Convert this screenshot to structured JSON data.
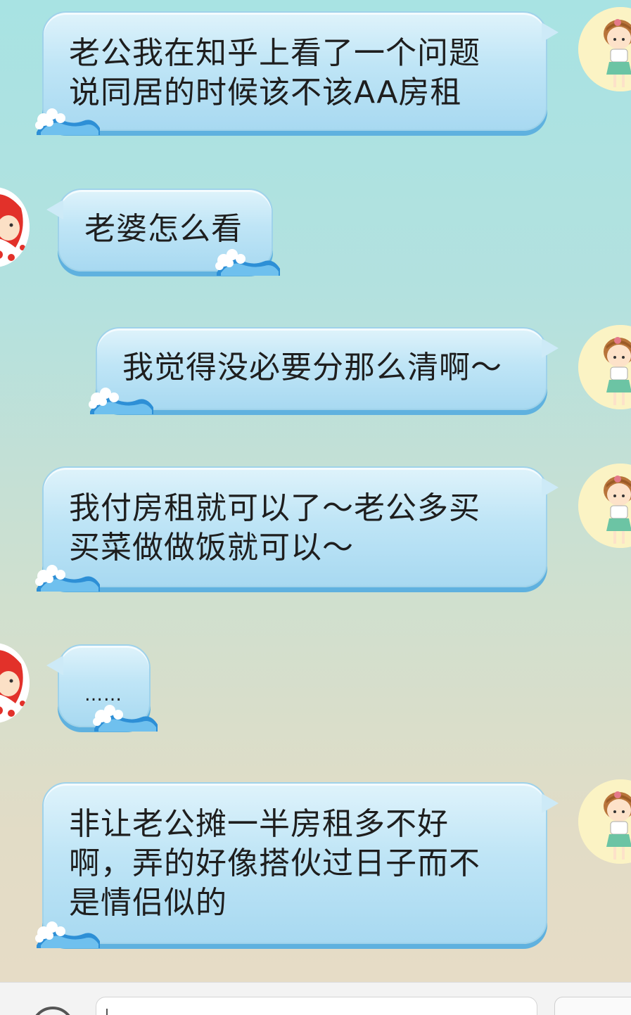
{
  "messages": [
    {
      "sender": "self",
      "text": "老公我在知乎上看了一个问题\n说同居的时候该不该AA房租"
    },
    {
      "sender": "other",
      "text": "老婆怎么看"
    },
    {
      "sender": "self",
      "text": "我觉得没必要分那么清啊～"
    },
    {
      "sender": "self",
      "text": "我付房租就可以了～老公多买\n买菜做做饭就可以～"
    },
    {
      "sender": "other",
      "text": "……"
    },
    {
      "sender": "self",
      "text": "非让老公摊一半房租多不好\n啊，弄的好像搭伙过日子而不\n是情侣似的"
    }
  ],
  "input": {
    "value": ""
  },
  "colors": {
    "bubble": "#bfe5f6",
    "bubble_edge": "#5fb1df",
    "bg_top": "#a8e3e3",
    "bg_bottom": "#e6dcc6"
  },
  "icons": {
    "self_avatar": "cartoon-girl-avatar",
    "other_avatar": "cartoon-red-hair-avatar",
    "bubble_decoration": "wave-icon",
    "voice": "voice-icon"
  }
}
